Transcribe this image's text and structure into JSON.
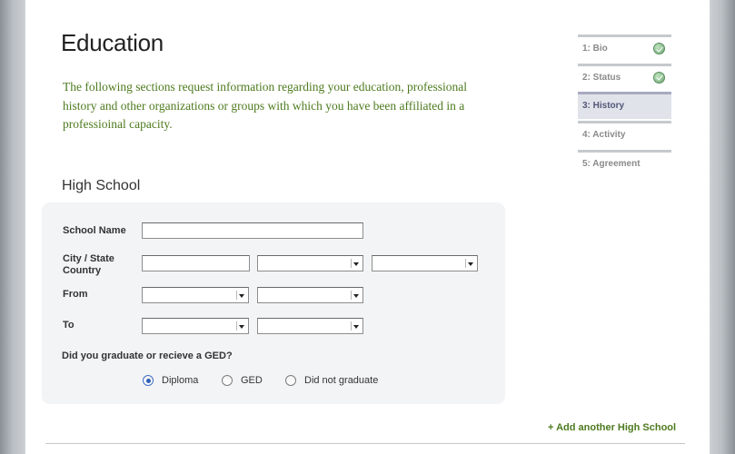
{
  "page": {
    "title": "Education",
    "intro": "The following sections request information regarding your education, professional history and other organizations or groups with which you have been affiliated in a professioinal capacity."
  },
  "high_school": {
    "section_title": "High School",
    "labels": {
      "school_name": "School Name",
      "city_state": "City / State",
      "country": "Country",
      "from": "From",
      "to": "To"
    },
    "fields": {
      "school_name": "",
      "city": "",
      "state": "",
      "country": "",
      "from_month": "",
      "from_year": "",
      "to_month": "",
      "to_year": ""
    },
    "graduation": {
      "question": "Did you graduate or recieve a GED?",
      "options": [
        {
          "label": "Diploma",
          "selected": true
        },
        {
          "label": "GED",
          "selected": false
        },
        {
          "label": "Did not graduate",
          "selected": false
        }
      ]
    },
    "add_link": "+  Add another High School"
  },
  "steps": [
    {
      "label": "1:  Bio",
      "status": "complete"
    },
    {
      "label": "2:  Status",
      "status": "complete"
    },
    {
      "label": "3:  History",
      "status": "active"
    },
    {
      "label": "4:  Activity",
      "status": "pending"
    },
    {
      "label": "5:  Agreement",
      "status": "pending"
    }
  ],
  "colors": {
    "accent_green": "#4d7a1e",
    "active_step_bg": "#e1e3ea",
    "panel_bg": "#f3f4f6"
  },
  "icons": {
    "complete": "checkmark-icon",
    "dropdown": "chevron-down-icon"
  }
}
